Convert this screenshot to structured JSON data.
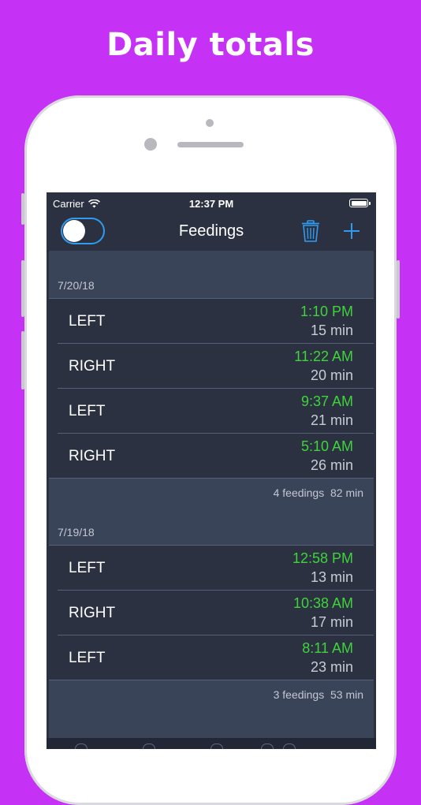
{
  "headline": "Daily totals",
  "status_bar": {
    "carrier": "Carrier",
    "time": "12:37 PM"
  },
  "nav": {
    "title": "Feedings",
    "toggle_on": false
  },
  "icons": {
    "trash": "trash-icon",
    "add": "plus-icon",
    "wifi": "wifi-icon",
    "battery": "battery-icon"
  },
  "colors": {
    "background": "#c531f5",
    "accent": "#2f9cf0",
    "time_green": "#3fd43b"
  },
  "days": [
    {
      "date": "7/20/18",
      "feedings": [
        {
          "side": "LEFT",
          "time": "1:10 PM",
          "duration": "15 min"
        },
        {
          "side": "RIGHT",
          "time": "11:22 AM",
          "duration": "20 min"
        },
        {
          "side": "LEFT",
          "time": "9:37 AM",
          "duration": "21 min"
        },
        {
          "side": "RIGHT",
          "time": "5:10 AM",
          "duration": "26 min"
        }
      ],
      "summary": "4 feedings  82 min"
    },
    {
      "date": "7/19/18",
      "feedings": [
        {
          "side": "LEFT",
          "time": "12:58 PM",
          "duration": "13 min"
        },
        {
          "side": "RIGHT",
          "time": "10:38 AM",
          "duration": "17 min"
        },
        {
          "side": "LEFT",
          "time": "8:11 AM",
          "duration": "23 min"
        }
      ],
      "summary": "3 feedings  53 min"
    }
  ]
}
